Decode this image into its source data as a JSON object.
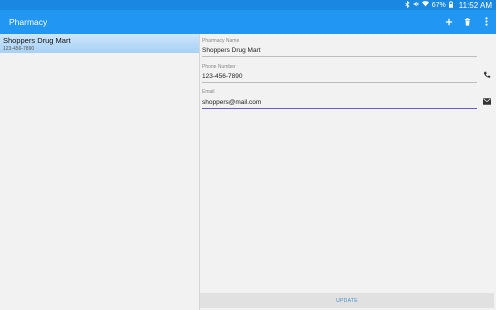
{
  "status_bar": {
    "battery": "67%",
    "time": "11:52 AM"
  },
  "app_bar": {
    "title": "Pharmacy",
    "icons": [
      "add-icon",
      "delete-icon",
      "more-vert-icon"
    ]
  },
  "list": {
    "items": [
      {
        "name": "Shoppers Drug Mart",
        "phone": "123-456-7890",
        "selected": true
      }
    ]
  },
  "detail": {
    "name_label": "Pharmacy Name",
    "name_value": "Shoppers Drug Mart",
    "phone_label": "Phone Number",
    "phone_value": "123-456-7890",
    "email_label": "Email",
    "email_value": "shoppers@mail.com",
    "update_label": "UPDATE"
  },
  "colors": {
    "status_bar": "#1a88e2",
    "app_bar": "#2196f3",
    "selected_item": "#a6d1f6",
    "update_text": "#4a90c8",
    "focus_underline": "#6a5acd"
  }
}
